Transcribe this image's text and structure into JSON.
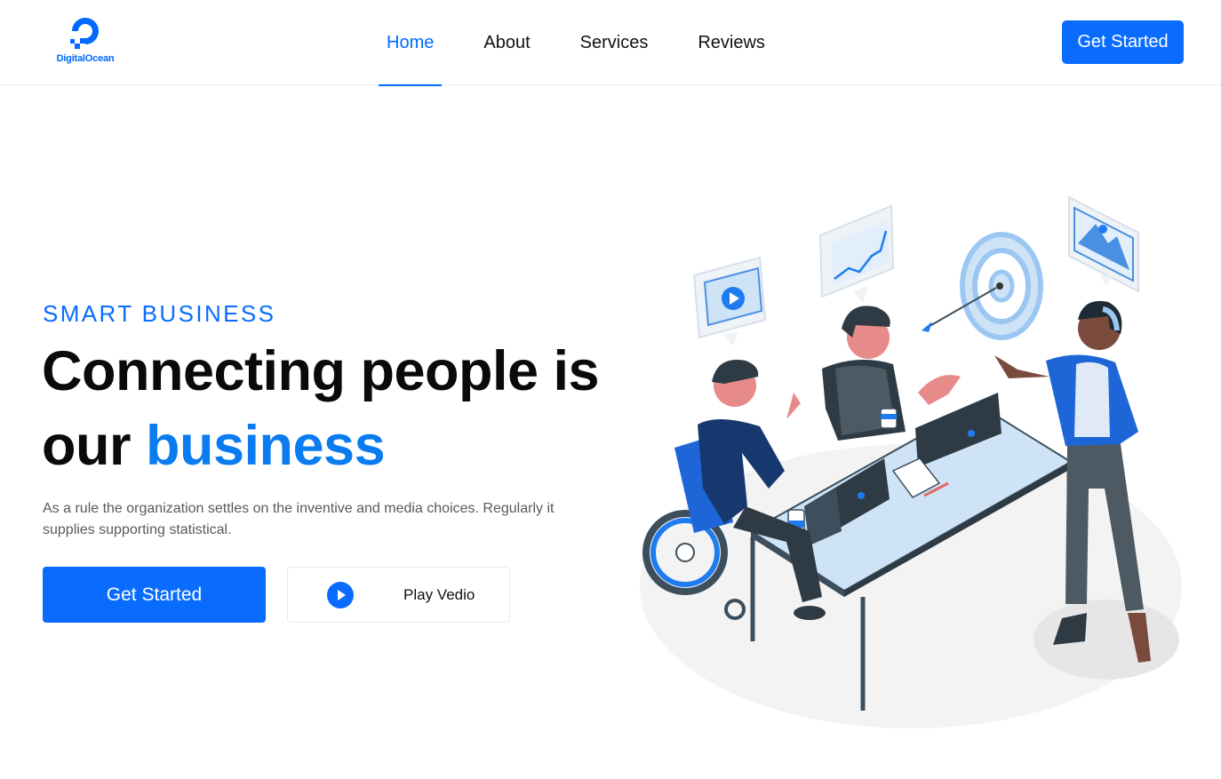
{
  "brand": {
    "name": "DigitalOcean",
    "color": "#0069ff"
  },
  "nav": {
    "items": [
      {
        "label": "Home",
        "active": true
      },
      {
        "label": "About",
        "active": false
      },
      {
        "label": "Services",
        "active": false
      },
      {
        "label": "Reviews",
        "active": false
      }
    ],
    "cta_label": "Get Started"
  },
  "hero": {
    "eyebrow": "SMART BUSINESS",
    "headline_part1": "Connecting people is our",
    "headline_accent": "business",
    "description": "As a rule the organization settles on the inventive and media choices. Regularly it supplies supporting statistical.",
    "primary_label": "Get Started",
    "video_label": "Play Vedio",
    "illustration_icon": "team-meeting-illustration"
  },
  "colors": {
    "accent": "#0a6cff",
    "text": "#0a0a0a",
    "muted": "#5a5a5a",
    "light_blue": "#cfe3f7"
  }
}
